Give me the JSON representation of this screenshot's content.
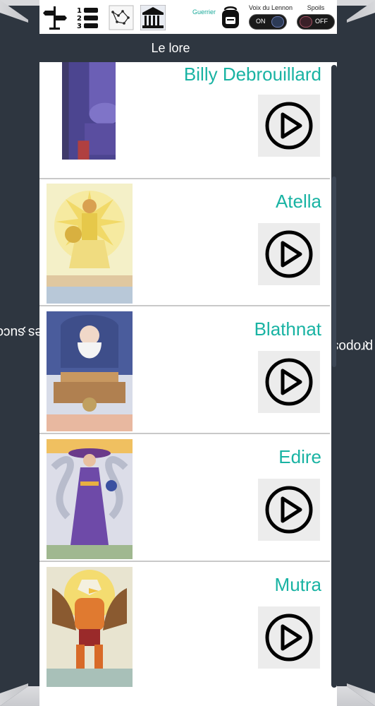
{
  "toolbar": {
    "icons": [
      "signpost-icon",
      "ranking-list-icon",
      "constellation-map-icon",
      "museum-icon",
      "backpack-icon"
    ],
    "character_class": "Guerrier",
    "voice_toggle": {
      "label": "Voix du Lennon",
      "state": "ON"
    },
    "spoils_toggle": {
      "label": "Spoils",
      "state": "OFF"
    }
  },
  "title": "Le lore",
  "side": {
    "left_label": "Les succès",
    "left_arrow": "‹",
    "right_label": "À propos",
    "right_arrow": "›"
  },
  "characters": [
    {
      "name": "Billy Debrouillard",
      "palette": [
        "#4a3f8f",
        "#7a6fc0",
        "#c04a4a"
      ]
    },
    {
      "name": "Atella",
      "palette": [
        "#e8d36a",
        "#f4f0c0",
        "#b0862c"
      ]
    },
    {
      "name": "Blathnat",
      "palette": [
        "#4a5a9a",
        "#d9d0c0",
        "#c9a070"
      ]
    },
    {
      "name": "Edire",
      "palette": [
        "#6a4aa0",
        "#c8c8d8",
        "#e8b050"
      ]
    },
    {
      "name": "Mutra",
      "palette": [
        "#e07a30",
        "#8a4a2a",
        "#f0d040"
      ]
    }
  ]
}
